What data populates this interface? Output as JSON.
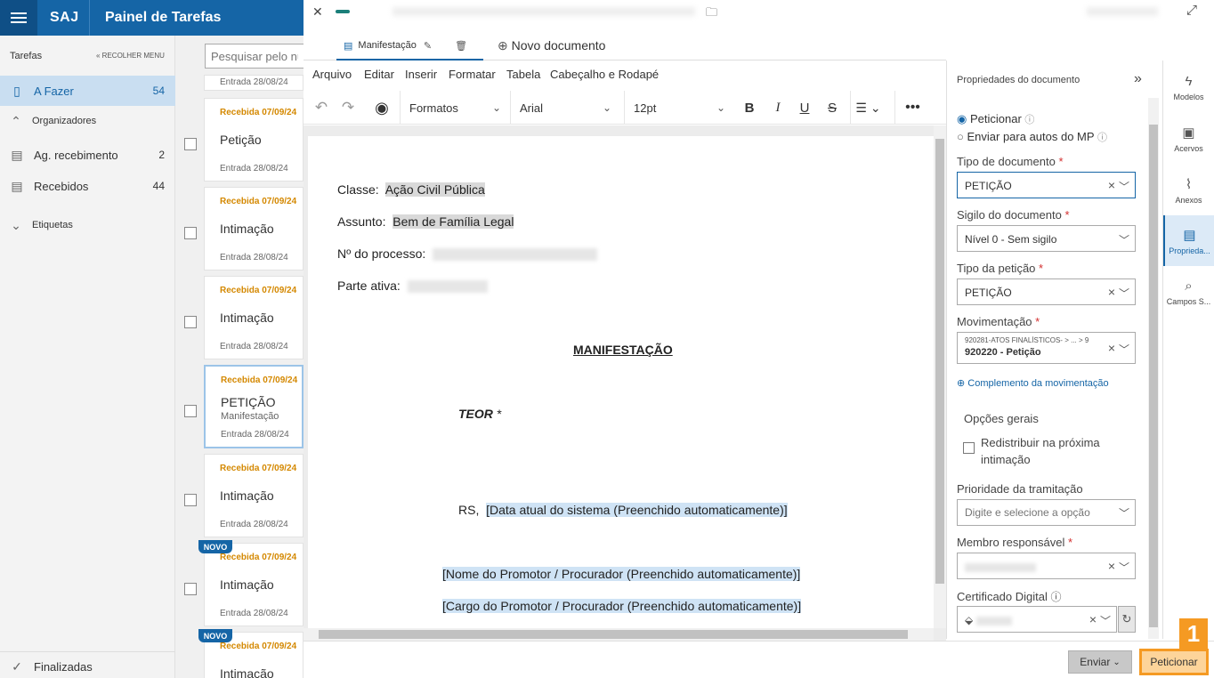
{
  "header": {
    "brand": "SAJ",
    "title": "Painel de Tarefas"
  },
  "sidebar": {
    "section_title": "Tarefas",
    "collapse_label": "RECOLHER MENU",
    "afazer": {
      "label": "A Fazer",
      "count": "54"
    },
    "organizadores": "Organizadores",
    "ag_recebimento": {
      "label": "Ag. recebimento",
      "count": "2"
    },
    "recebidos": {
      "label": "Recebidos",
      "count": "44"
    },
    "etiquetas": "Etiquetas",
    "finalizadas": "Finalizadas"
  },
  "tasks": {
    "search_placeholder": "Pesquisar pelo número",
    "top_entry": "Entrada 28/08/24",
    "items": [
      {
        "received": "Recebida 07/09/24",
        "title": "Petição",
        "subtitle": "",
        "entry": "Entrada 28/08/24",
        "novo": ""
      },
      {
        "received": "Recebida 07/09/24",
        "title": "Intimação",
        "subtitle": "",
        "entry": "Entrada 28/08/24",
        "novo": ""
      },
      {
        "received": "Recebida 07/09/24",
        "title": "Intimação",
        "subtitle": "",
        "entry": "Entrada 28/08/24",
        "novo": ""
      },
      {
        "received": "Recebida 07/09/24",
        "title": "PETIÇÃO",
        "subtitle": "Manifestação",
        "entry": "Entrada 28/08/24",
        "novo": ""
      },
      {
        "received": "Recebida 07/09/24",
        "title": "Intimação",
        "subtitle": "",
        "entry": "Entrada 28/08/24",
        "novo": ""
      },
      {
        "received": "Recebida 07/09/24",
        "title": "Intimação",
        "subtitle": "",
        "entry": "Entrada 28/08/24",
        "novo": "NOVO"
      },
      {
        "received": "Recebida 07/09/24",
        "title": "Intimação",
        "subtitle": "",
        "entry": "",
        "novo": "NOVO"
      }
    ]
  },
  "editor": {
    "doc_tab": "Manifestação",
    "new_doc": "Novo documento",
    "menu": [
      "Arquivo",
      "Editar",
      "Inserir",
      "Formatar",
      "Tabela",
      "Cabeçalho e Rodapé"
    ],
    "formats": "Formatos",
    "font": "Arial",
    "size": "12pt"
  },
  "document": {
    "classe_label": "Classe:",
    "classe_value": "Ação Civil Pública",
    "assunto_label": "Assunto:",
    "assunto_value": "Bem de Família Legal",
    "processo_label": "Nº do processo:",
    "parte_label": "Parte ativa:",
    "heading": "MANIFESTAÇÃO",
    "teor": "TEOR",
    "teor_mark": "*",
    "rs": "RS,",
    "date_placeholder": "[Data atual do sistema (Preenchido automaticamente)]",
    "name_placeholder": "[Nome do Promotor / Procurador (Preenchido automaticamente)]",
    "role_placeholder": "[Cargo do Promotor / Procurador (Preenchido automaticamente)]"
  },
  "properties": {
    "title": "Propriedades do documento",
    "radio_peticionar": "Peticionar",
    "radio_enviar": "Enviar para autos do MP",
    "tipo_documento_label": "Tipo de documento",
    "tipo_documento_value": "PETIÇÃO",
    "sigilo_label": "Sigilo do documento",
    "sigilo_value": "Nível 0 - Sem sigilo",
    "tipo_peticao_label": "Tipo da petição",
    "tipo_peticao_value": "PETIÇÃO",
    "movimentacao_label": "Movimentação",
    "movimentacao_path": "920281-ATOS FINALÍSTICOS- > ... > 9",
    "movimentacao_value": "920220 - Petição",
    "complemento": "Complemento da movimentação",
    "opcoes_gerais": "Opções gerais",
    "redistribuir_1": "Redistribuir na próxima",
    "redistribuir_2": "intimação",
    "prioridade_label": "Prioridade da tramitação",
    "prioridade_placeholder": "Digite e selecione a opção",
    "membro_label": "Membro responsável",
    "certificado_label": "Certificado Digital",
    "required_mark": "*"
  },
  "rail": [
    "Modelos",
    "Acervos",
    "Anexos",
    "Proprieda...",
    "Campos S..."
  ],
  "footer": {
    "enviar": "Enviar",
    "peticionar": "Peticionar",
    "step": "1"
  },
  "colors": {
    "brand": "#1565a6",
    "accent_orange": "#f59a23",
    "received_orange": "#d48800"
  }
}
